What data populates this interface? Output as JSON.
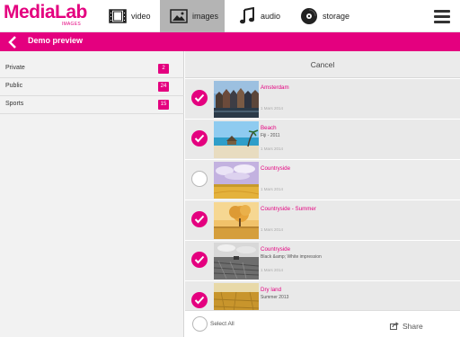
{
  "logo": {
    "main": "MediaLab",
    "sub": "IMAGES"
  },
  "nav": [
    {
      "label": "video",
      "icon": "film-icon"
    },
    {
      "label": "images",
      "icon": "image-icon"
    },
    {
      "label": "audio",
      "icon": "music-note-icon"
    },
    {
      "label": "storage",
      "icon": "disc-icon"
    }
  ],
  "header": {
    "title": "Demo preview",
    "back_icon": "chevron-left-icon"
  },
  "colors": {
    "accent": "#e4007f",
    "selected_tab": "#b4b4b4"
  },
  "categories": [
    {
      "name": "Private",
      "count": "2"
    },
    {
      "name": "Public",
      "count": "24"
    },
    {
      "name": "Sports",
      "count": "15"
    }
  ],
  "panel": {
    "cancel": "Cancel"
  },
  "images": [
    {
      "name": "Amsterdam",
      "subtitle": "",
      "date": "1 Mars 2014",
      "selected": true
    },
    {
      "name": "Beach",
      "subtitle": "Fiji - 2011",
      "date": "1 Mars 2014",
      "selected": true
    },
    {
      "name": "Countryside",
      "subtitle": "",
      "date": "1 Mars 2014",
      "selected": false
    },
    {
      "name": "Countryside - Summer",
      "subtitle": "",
      "date": "1 Mars 2014",
      "selected": true
    },
    {
      "name": "Countryside",
      "subtitle": "Black &amp; White impression",
      "date": "1 Mars 2014",
      "selected": true
    },
    {
      "name": "Dry land",
      "subtitle": "Summer 2013",
      "date": "",
      "selected": true
    }
  ],
  "footer": {
    "select_all": "Select All",
    "share": "Share"
  }
}
